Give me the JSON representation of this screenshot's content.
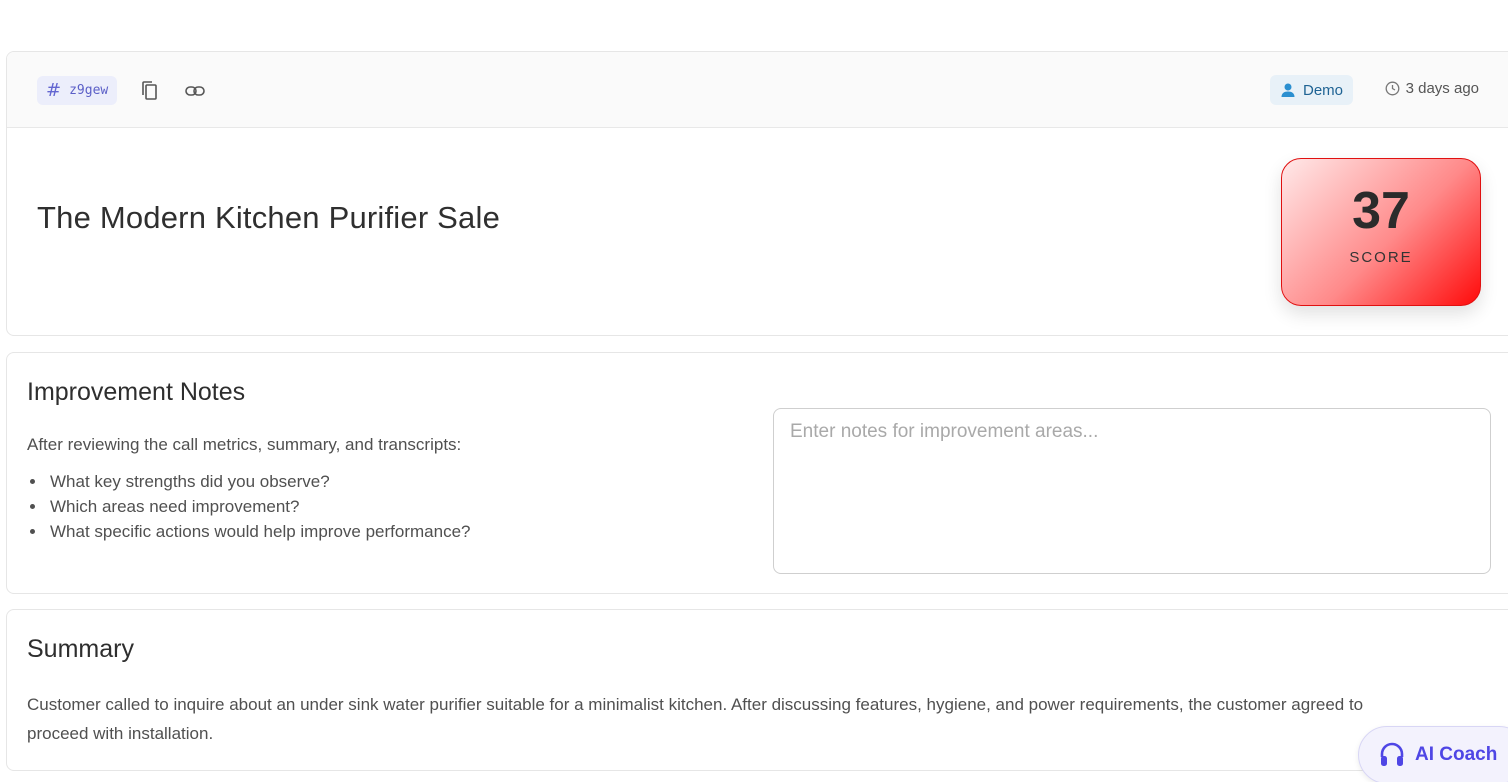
{
  "header": {
    "call_id": "z9gew",
    "icons": {
      "hash": "hash-icon",
      "copy": "copy-icon",
      "link": "link-icon",
      "user": "user-icon",
      "clock": "clock-icon"
    },
    "user_label": "Demo",
    "time_label": "3 days ago",
    "title": "The Modern Kitchen Purifier Sale",
    "score": {
      "value": "37",
      "label": "SCORE"
    }
  },
  "notes": {
    "title": "Improvement Notes",
    "intro": "After reviewing the call metrics, summary, and transcripts:",
    "bullets": [
      "What key strengths did you observe?",
      "Which areas need improvement?",
      "What specific actions would help improve performance?"
    ],
    "placeholder": "Enter notes for improvement areas...",
    "value": ""
  },
  "summary": {
    "title": "Summary",
    "text": "Customer called to inquire about an under sink water purifier suitable for a minimalist kitchen. After discussing features, hygiene, and power requirements, the customer agreed to proceed with installation."
  },
  "ai_coach": {
    "label": "AI Coach",
    "icon": "headset-icon"
  },
  "colors": {
    "accent": "#6366d1",
    "score_red": "#ff0a0a",
    "demo_blue": "#1f6394"
  }
}
